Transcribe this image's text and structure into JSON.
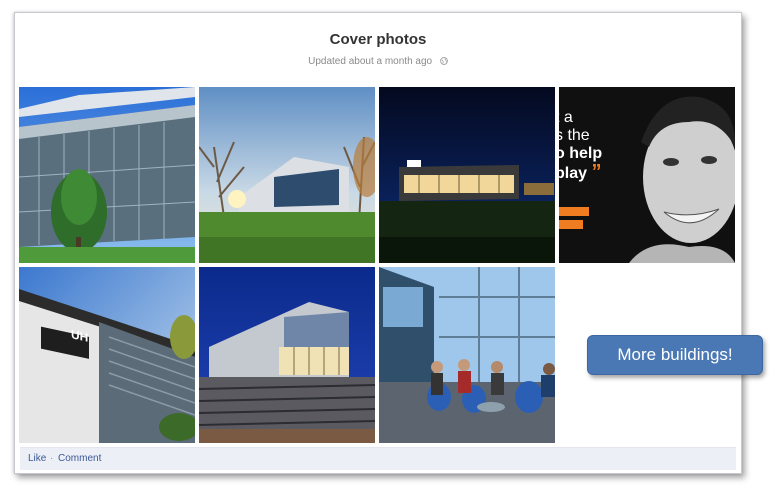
{
  "album": {
    "title": "Cover photos",
    "updated": "Updated about a month ago",
    "privacy_icon": "globe-icon"
  },
  "photos": [
    {
      "subject": "glass-building-with-tree"
    },
    {
      "subject": "modern-building-at-sunset"
    },
    {
      "subject": "building-at-night"
    },
    {
      "subject": "student-portrait-banner",
      "banner_text": [
        "t a",
        "s the",
        "o help",
        "play"
      ],
      "quote_mark": "”"
    },
    {
      "subject": "building-uh-sign",
      "sign_text": "UH"
    },
    {
      "subject": "building-dusk-steps"
    },
    {
      "subject": "students-in-atrium"
    }
  ],
  "footer": {
    "like_label": "Like",
    "separator": "·",
    "comment_label": "Comment"
  },
  "callout": {
    "text": "More buildings!"
  },
  "colors": {
    "link": "#3b5998",
    "callout_bg": "#4a78b5",
    "banner_accent": "#f07c22"
  }
}
